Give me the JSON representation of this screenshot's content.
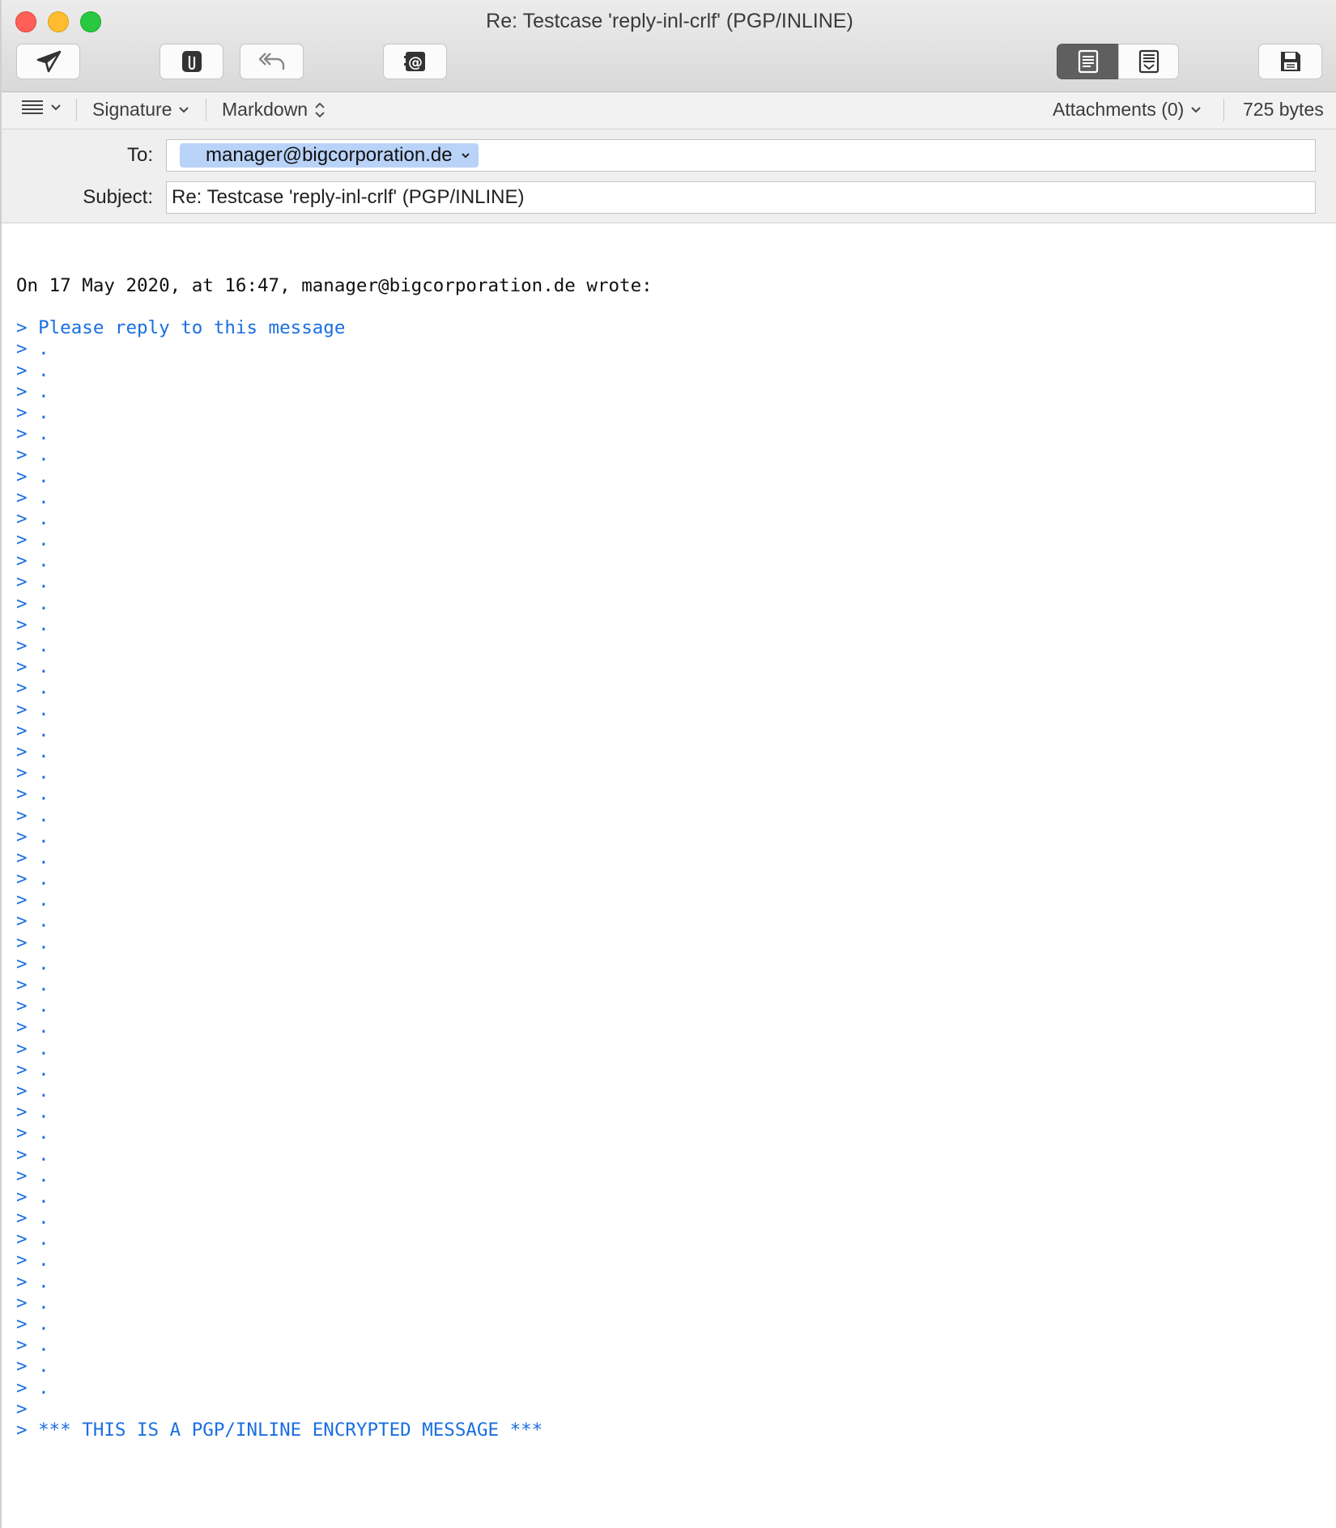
{
  "window": {
    "title": "Re: Testcase 'reply-inl-crlf' (PGP/INLINE)"
  },
  "toolbar": {
    "buttons": [
      "send-icon",
      "attach-icon",
      "reply-icon",
      "address-icon",
      "edit-view-icon",
      "preview-view-icon",
      "save-icon"
    ]
  },
  "format_bar": {
    "signature_label": "Signature",
    "markdown_label": "Markdown",
    "attachments_label": "Attachments (0)",
    "size_label": "725 bytes"
  },
  "headers": {
    "to_label": "To:",
    "to_value": "manager@bigcorporation.de",
    "subject_label": "Subject:",
    "subject_value": "Re: Testcase 'reply-inl-crlf' (PGP/INLINE)"
  },
  "message": {
    "intro": "On 17 May 2020, at 16:47, manager@bigcorporation.de wrote:",
    "quoted_lines": [
      "> Please reply to this message",
      "> .",
      "> .",
      "> .",
      "> .",
      "> .",
      "> .",
      "> .",
      "> .",
      "> .",
      "> .",
      "> .",
      "> .",
      "> .",
      "> .",
      "> .",
      "> .",
      "> .",
      "> .",
      "> .",
      "> .",
      "> .",
      "> .",
      "> .",
      "> .",
      "> .",
      "> .",
      "> .",
      "> .",
      "> .",
      "> .",
      "> .",
      "> .",
      "> .",
      "> .",
      "> .",
      "> .",
      "> .",
      "> .",
      "> .",
      "> .",
      "> .",
      "> .",
      "> .",
      "> .",
      "> .",
      "> .",
      "> .",
      "> .",
      "> .",
      "> .",
      ">",
      "> *** THIS IS A PGP/INLINE ENCRYPTED MESSAGE ***"
    ]
  },
  "colors": {
    "quote": "#1a6fe0",
    "token": "#b9d2f7"
  }
}
